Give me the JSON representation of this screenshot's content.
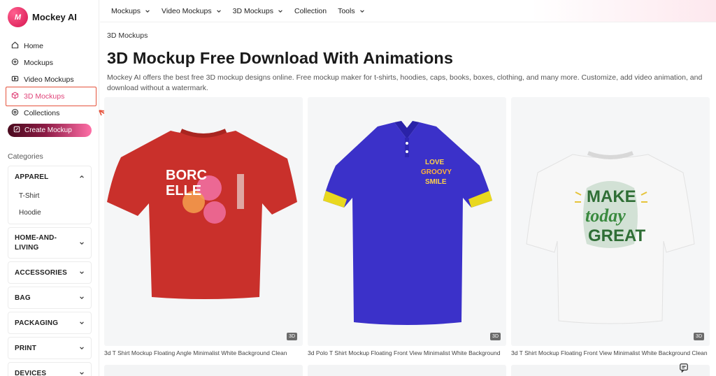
{
  "brand": {
    "name": "Mockey AI",
    "logo_text": "M"
  },
  "sidebar": {
    "items": [
      {
        "label": "Home",
        "icon": "home-icon"
      },
      {
        "label": "Mockups",
        "icon": "mockup-icon"
      },
      {
        "label": "Video Mockups",
        "icon": "video-icon"
      },
      {
        "label": "3D Mockups",
        "icon": "cube-icon",
        "active": true
      },
      {
        "label": "Collections",
        "icon": "collection-icon"
      }
    ],
    "create_button": "Create Mockup",
    "categories_title": "Categories",
    "categories": [
      {
        "label": "APPAREL",
        "expanded": true,
        "children": [
          "T-Shirt",
          "Hoodie"
        ]
      },
      {
        "label": "HOME-AND-LIVING",
        "label_lines": [
          "HOME-AND-",
          "LIVING"
        ]
      },
      {
        "label": "ACCESSORIES"
      },
      {
        "label": "BAG"
      },
      {
        "label": "PACKAGING"
      },
      {
        "label": "PRINT"
      },
      {
        "label": "DEVICES"
      }
    ]
  },
  "topnav": {
    "items": [
      {
        "label": "Mockups",
        "dropdown": true
      },
      {
        "label": "Video Mockups",
        "dropdown": true
      },
      {
        "label": "3D Mockups",
        "dropdown": true
      },
      {
        "label": "Collection",
        "dropdown": false
      },
      {
        "label": "Tools",
        "dropdown": true
      }
    ]
  },
  "main": {
    "breadcrumb": "3D Mockups",
    "title": "3D Mockup Free Download With Animations",
    "description": "Mockey AI offers the best free 3D mockup designs online. Free mockup maker for t-shirts, hoodies, caps, books, boxes, clothing, and many more. Customize, add video animation, and download without a watermark.",
    "cards": [
      {
        "badge": "3D",
        "caption": "3d T Shirt Mockup Floating Angle Minimalist White Background Clean",
        "shirt_color": "#c9302b",
        "print_text": [
          "BORC",
          "ELLE"
        ]
      },
      {
        "badge": "3D",
        "caption": "3d Polo T Shirt Mockup Floating Front View Minimalist White Background",
        "shirt_color": "#3b31c9",
        "trim_color": "#e9d81f",
        "print_text": [
          "LOVE",
          "GROOVY",
          "SMILE"
        ]
      },
      {
        "badge": "3D",
        "caption": "3d T Shirt Mockup Floating Front View Minimalist White Background Clean",
        "shirt_color": "#f4f4f4",
        "print_text": [
          "MAKE",
          "today",
          "GREAT"
        ]
      }
    ]
  },
  "colors": {
    "accent": "#e0457a",
    "highlight_box": "#e5533c"
  }
}
